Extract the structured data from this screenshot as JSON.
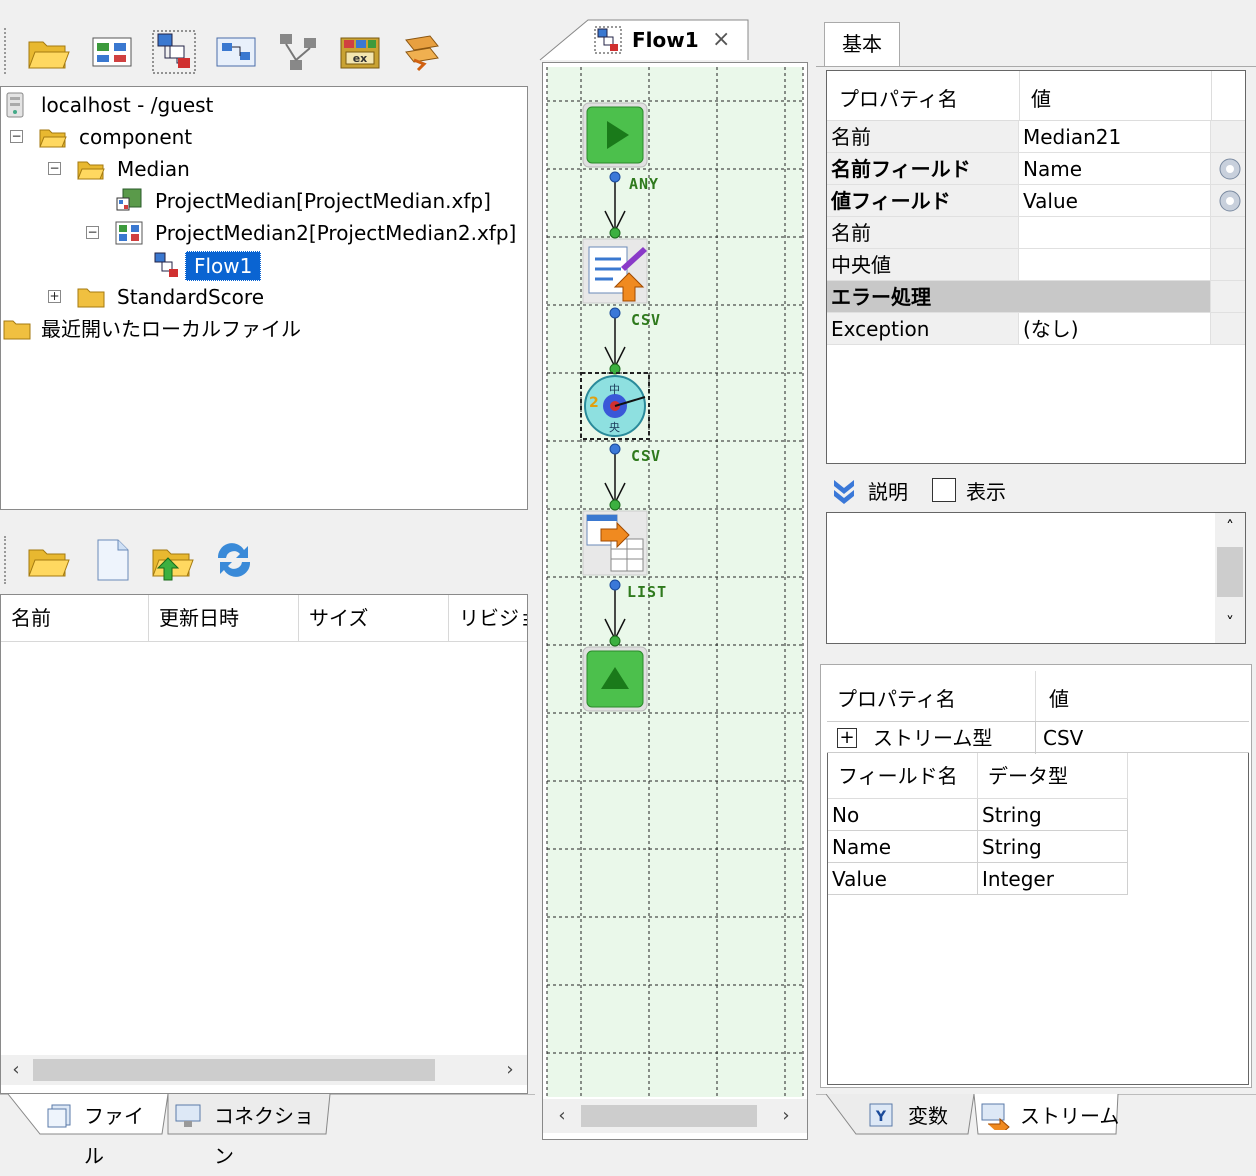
{
  "explorer": {
    "tree": {
      "root": "localhost - /guest",
      "component": "component",
      "median": "Median",
      "project1": "ProjectMedian[ProjectMedian.xfp]",
      "project2": "ProjectMedian2[ProjectMedian2.xfp]",
      "flow": "Flow1",
      "standard": "StandardScore",
      "recent": "最近開いたローカルファイル"
    },
    "files": {
      "columns": [
        "名前",
        "更新日時",
        "サイズ",
        "リビジョ"
      ]
    },
    "tabs": [
      "ファイル",
      "コネクション"
    ]
  },
  "editor": {
    "tab_title": "Flow1",
    "close_glyph": "×",
    "connections": [
      "ANY",
      "CSV",
      "CSV",
      "LIST"
    ],
    "median_glyph_top": "中",
    "median_glyph_bottom": "央",
    "median_glyph_left": "2"
  },
  "properties": {
    "tab": "基本",
    "header_name": "プロパティ名",
    "header_value": "値",
    "rows": [
      {
        "key": "名前",
        "value": "Median21"
      },
      {
        "key": "名前フィールド",
        "value": "Name"
      },
      {
        "key": "値フィールド",
        "value": "Value"
      },
      {
        "key": "名前",
        "value": ""
      },
      {
        "key": "中央値",
        "value": ""
      },
      {
        "key": "エラー処理",
        "value": ""
      },
      {
        "key": "Exception",
        "value": "(なし)"
      }
    ],
    "description_label": "説明",
    "show_label": "表示"
  },
  "stream": {
    "header_name": "プロパティ名",
    "header_value": "値",
    "type_key": "ストリーム型",
    "type_value": "CSV",
    "expand_glyph": "+",
    "field_header": "フィールド名",
    "datatype_header": "データ型",
    "fields": [
      {
        "name": "No",
        "type": "String"
      },
      {
        "name": "Name",
        "type": "String"
      },
      {
        "name": "Value",
        "type": "Integer"
      }
    ],
    "tabs": [
      "変数",
      "ストリーム"
    ]
  }
}
